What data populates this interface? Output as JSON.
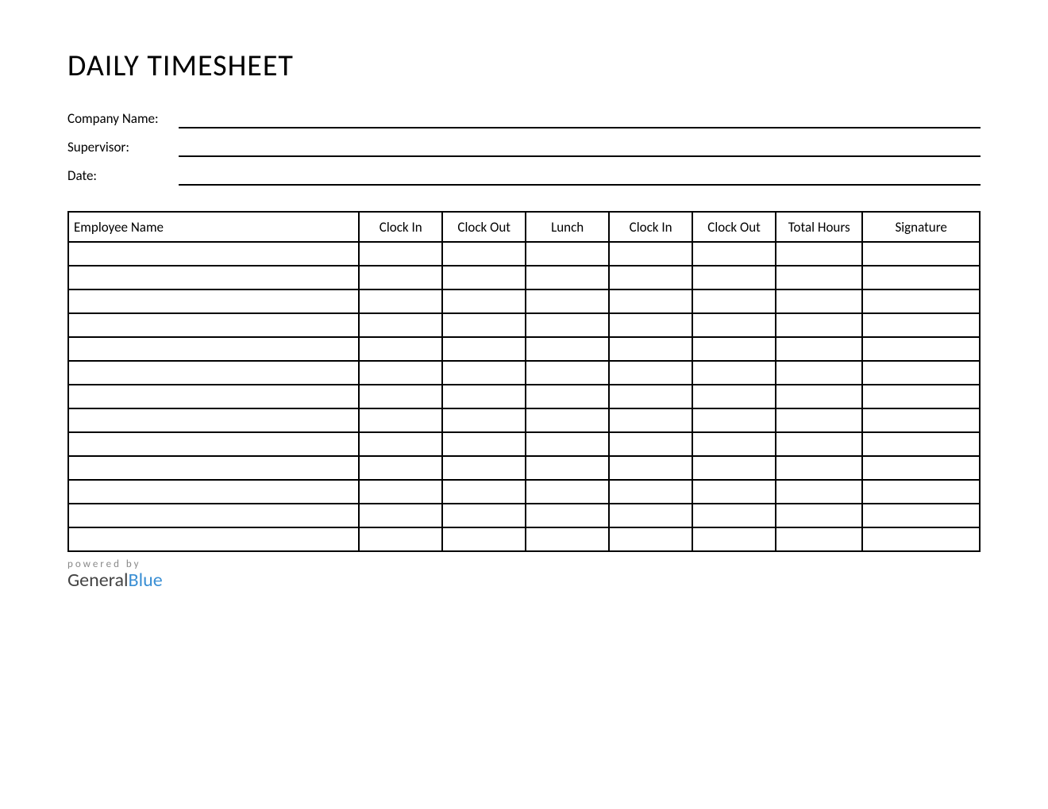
{
  "title": "DAILY TIMESHEET",
  "info": {
    "company_label": "Company Name:",
    "supervisor_label": "Supervisor:",
    "date_label": "Date:",
    "company_value": "",
    "supervisor_value": "",
    "date_value": ""
  },
  "table": {
    "headers": [
      "Employee Name",
      "Clock In",
      "Clock Out",
      "Lunch",
      "Clock In",
      "Clock Out",
      "Total Hours",
      "Signature"
    ],
    "rows": [
      {
        "employee_name": "",
        "clock_in_1": "",
        "clock_out_1": "",
        "lunch": "",
        "clock_in_2": "",
        "clock_out_2": "",
        "total_hours": "",
        "signature": ""
      },
      {
        "employee_name": "",
        "clock_in_1": "",
        "clock_out_1": "",
        "lunch": "",
        "clock_in_2": "",
        "clock_out_2": "",
        "total_hours": "",
        "signature": ""
      },
      {
        "employee_name": "",
        "clock_in_1": "",
        "clock_out_1": "",
        "lunch": "",
        "clock_in_2": "",
        "clock_out_2": "",
        "total_hours": "",
        "signature": ""
      },
      {
        "employee_name": "",
        "clock_in_1": "",
        "clock_out_1": "",
        "lunch": "",
        "clock_in_2": "",
        "clock_out_2": "",
        "total_hours": "",
        "signature": ""
      },
      {
        "employee_name": "",
        "clock_in_1": "",
        "clock_out_1": "",
        "lunch": "",
        "clock_in_2": "",
        "clock_out_2": "",
        "total_hours": "",
        "signature": ""
      },
      {
        "employee_name": "",
        "clock_in_1": "",
        "clock_out_1": "",
        "lunch": "",
        "clock_in_2": "",
        "clock_out_2": "",
        "total_hours": "",
        "signature": ""
      },
      {
        "employee_name": "",
        "clock_in_1": "",
        "clock_out_1": "",
        "lunch": "",
        "clock_in_2": "",
        "clock_out_2": "",
        "total_hours": "",
        "signature": ""
      },
      {
        "employee_name": "",
        "clock_in_1": "",
        "clock_out_1": "",
        "lunch": "",
        "clock_in_2": "",
        "clock_out_2": "",
        "total_hours": "",
        "signature": ""
      },
      {
        "employee_name": "",
        "clock_in_1": "",
        "clock_out_1": "",
        "lunch": "",
        "clock_in_2": "",
        "clock_out_2": "",
        "total_hours": "",
        "signature": ""
      },
      {
        "employee_name": "",
        "clock_in_1": "",
        "clock_out_1": "",
        "lunch": "",
        "clock_in_2": "",
        "clock_out_2": "",
        "total_hours": "",
        "signature": ""
      },
      {
        "employee_name": "",
        "clock_in_1": "",
        "clock_out_1": "",
        "lunch": "",
        "clock_in_2": "",
        "clock_out_2": "",
        "total_hours": "",
        "signature": ""
      },
      {
        "employee_name": "",
        "clock_in_1": "",
        "clock_out_1": "",
        "lunch": "",
        "clock_in_2": "",
        "clock_out_2": "",
        "total_hours": "",
        "signature": ""
      },
      {
        "employee_name": "",
        "clock_in_1": "",
        "clock_out_1": "",
        "lunch": "",
        "clock_in_2": "",
        "clock_out_2": "",
        "total_hours": "",
        "signature": ""
      }
    ]
  },
  "footer": {
    "powered_by": "powered by",
    "brand_part1": "General",
    "brand_part2": "Blue"
  }
}
